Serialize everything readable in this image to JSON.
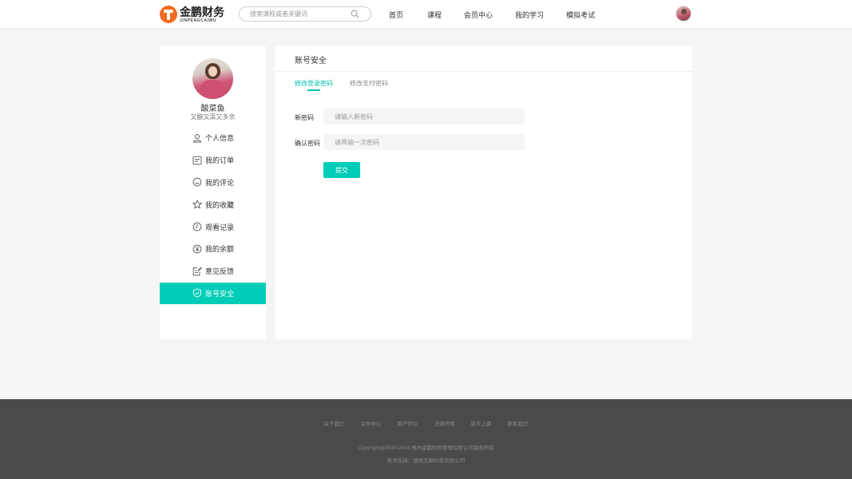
{
  "header": {
    "logo_cn": "金鹏财务",
    "logo_en": "JINPENGCAIWU",
    "search_placeholder": "搜索课程或者关键词",
    "nav": [
      "首页",
      "课程",
      "会员中心",
      "我的学习",
      "模拟考试"
    ]
  },
  "sidebar": {
    "username": "酸菜鱼",
    "bio": "又酸又菜又多余",
    "items": [
      {
        "label": "个人信息",
        "icon": "user-icon"
      },
      {
        "label": "我的订单",
        "icon": "order-icon"
      },
      {
        "label": "我的评论",
        "icon": "comment-icon"
      },
      {
        "label": "我的收藏",
        "icon": "star-icon"
      },
      {
        "label": "观看记录",
        "icon": "clock-icon"
      },
      {
        "label": "我的余额",
        "icon": "yen-icon"
      },
      {
        "label": "意见反馈",
        "icon": "feedback-icon"
      },
      {
        "label": "账号安全",
        "icon": "shield-icon",
        "active": true
      }
    ]
  },
  "main": {
    "title": "账号安全",
    "tabs": [
      "修改登录密码",
      "修改支付密码"
    ],
    "active_tab": 0,
    "fields": [
      {
        "label": "新密码",
        "placeholder": "请输入新密码",
        "value": ""
      },
      {
        "label": "确认密码",
        "placeholder": "请再输一次密码",
        "value": ""
      }
    ],
    "submit_label": "提交"
  },
  "footer": {
    "links": [
      "关于我们",
      "会员中心",
      "用户协议",
      "法律声明",
      "新手上路",
      "联系我们"
    ],
    "copyright": "Copyright@2020-2024 郑州金鹏财务管理有限公司版权所有",
    "support": "技术支持：透视互联科技有限公司"
  },
  "colors": {
    "accent": "#00cdb7",
    "logo_orange": "#f26b21",
    "footer_bg": "#4a4a4a",
    "page_bg": "#f5f5f5"
  }
}
